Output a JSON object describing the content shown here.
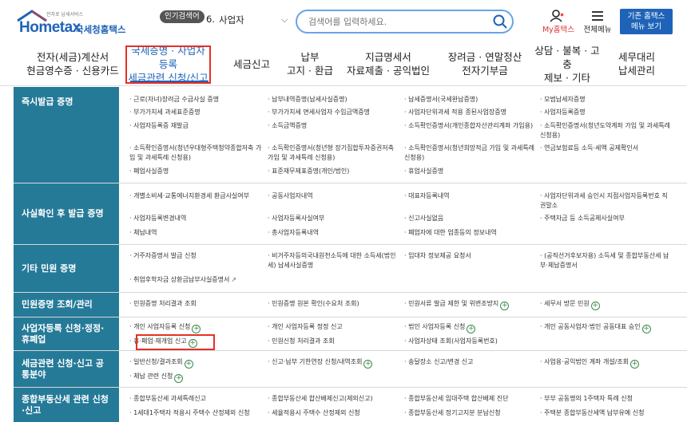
{
  "header": {
    "logo_brand": "Hometax",
    "logo_tagline": "전자로 납세서비스",
    "logo_kr": "국세청홈택스",
    "popular_badge": "인기검색어",
    "popular_num": "6.",
    "popular_term": "사업자",
    "search_placeholder": "검색어를 입력하세요.",
    "myhome_label": "My홈택스",
    "allmenu_label": "전체메뉴",
    "basic_btn_line1": "기존 홈택스",
    "basic_btn_line2": "메뉴 보기"
  },
  "gnb": {
    "items": [
      {
        "line1": "전자(세금)계산서",
        "line2": "현금영수증 · 신용카드"
      },
      {
        "line1": "국세증명 · 사업자등록",
        "line2": "세금관련 신청/신고"
      },
      {
        "line1": "세금신고",
        "line2": ""
      },
      {
        "line1": "납부",
        "line2": "고지 · 환급"
      },
      {
        "line1": "지급명세서",
        "line2": "자료제출 · 공익법인"
      },
      {
        "line1": "장려금 · 연말정산",
        "line2": "전자기부금"
      },
      {
        "line1": "상담 · 불복 · 고충",
        "line2": "제보 · 기타"
      },
      {
        "line1": "세무대리",
        "line2": "납세관리"
      }
    ]
  },
  "sections": {
    "s1": {
      "title": "즉시발급 증명",
      "items": [
        "· 근로(자녀)장려금 수급사실 증명",
        "· 납부내역증명(납세사실증명)",
        "· 납세증명서(국세완납증명)",
        "· 모범납세자증명",
        "· 부가가치세 과세표준증명",
        "· 부가가치세 면세사업자 수입금액증명",
        "· 사업자단위과세 적용 종된사업장증명",
        "· 사업자등록증명",
        "· 사업자등록증 재발급",
        "· 소득금액증명",
        "· 소득확인증명서(개인종합자산관리계좌 가입용)",
        "· 소득확인증명서(청년도약계좌 가입 및 과세특례 신청용)",
        "· 소득확인증명서(청년우대형주택청약종합저축 가입 및 과세특례 신청용)",
        "· 소득확인증명서(청년형 장기집합투자증권저축 가입 및 과세특례 신청용)",
        "· 소득확인증명서(청년희망적금 가입 및 과세특례 신청용)",
        "· 연금보험료등 소득·세액 공제확인서",
        "· 폐업사실증명",
        "· 표준재무제표증명(개인/법인)",
        "· 휴업사실증명"
      ]
    },
    "s2": {
      "title": "사실확인 후 발급 증명",
      "items": [
        "· 개별소비세·교통에너지환경세 환급사실여부",
        "· 공동사업자내역",
        "· 대표자등록내역",
        "· 사업자단위과세 승인시 지점사업자등록번호 직권말소",
        "· 사업자등록변경내역",
        "· 사업자등록사실여부",
        "· 신고사실없음",
        "· 주택자금 등 소득공제사실여부",
        "· 체납내역",
        "· 총사업자등록내역",
        "· 폐업자에 대한 업종등의 정보내역"
      ]
    },
    "s3": {
      "title": "기타 민원 증명",
      "items": [
        "· 거주자증명서 발급 신청",
        "· 비거주자등의국내원천소득에 대한 소득세(법인세) 납세사실증명",
        "· 임대차 정보제공 요청서",
        "· (공직선거후보자용) 소득세 및 종합부동산세 납부·체납증명서",
        "· 취업후학자금 상환금납부사실증명서"
      ]
    },
    "s4": {
      "title": "민원증명 조회/관리",
      "items": [
        "· 민원증명 처리결과 조회",
        "· 민원증명 원본 확인(수요처 조회)",
        "· 민원서류 발급 제한 및 위변조방지",
        "· 세무서 방문 민원"
      ]
    },
    "s5": {
      "title": "사업자등록 신청·정정·휴폐업",
      "items": [
        "· 개인 사업자등록 신청",
        "· 개인 사업자등록 정정 신고",
        "· 법인 사업자등록 신청",
        "· 개인 공동사업자·법인 공동대표 승인",
        "· 휴·폐업·재개업 신고",
        "· 민원신청 처리결과 조회",
        "· 사업자상태 조회(사업자등록번호)"
      ]
    },
    "s6": {
      "title": "세금관련 신청·신고 공통분야",
      "items": [
        "· 일반신청/결과조회",
        "· 신고·납부 기한연장 신청/내역조회",
        "· 송달장소 신고/변경 신고",
        "· 사업용·공익법인 계좌 개설/조회",
        "· 체납 관련 신청"
      ]
    },
    "s7": {
      "title": "종합부동산세 관련 신청·신고",
      "items": [
        "· 종합부동산세 과세특례신고",
        "· 종합부동산세 합산배제신고(제외신고)",
        "· 종합부동산세 임대주택 합산배제 진단",
        "· 부부 공동명의 1주택자 특례 신청",
        "· 1세대1주택자 적용시 주택수 산정제외 신청",
        "· 세율적용시 주택수 산정제외 신청",
        "· 종합부동산세 정기고지분 분납신청",
        "· 주택분 종합부동산세액 납부유예 신청"
      ]
    }
  }
}
